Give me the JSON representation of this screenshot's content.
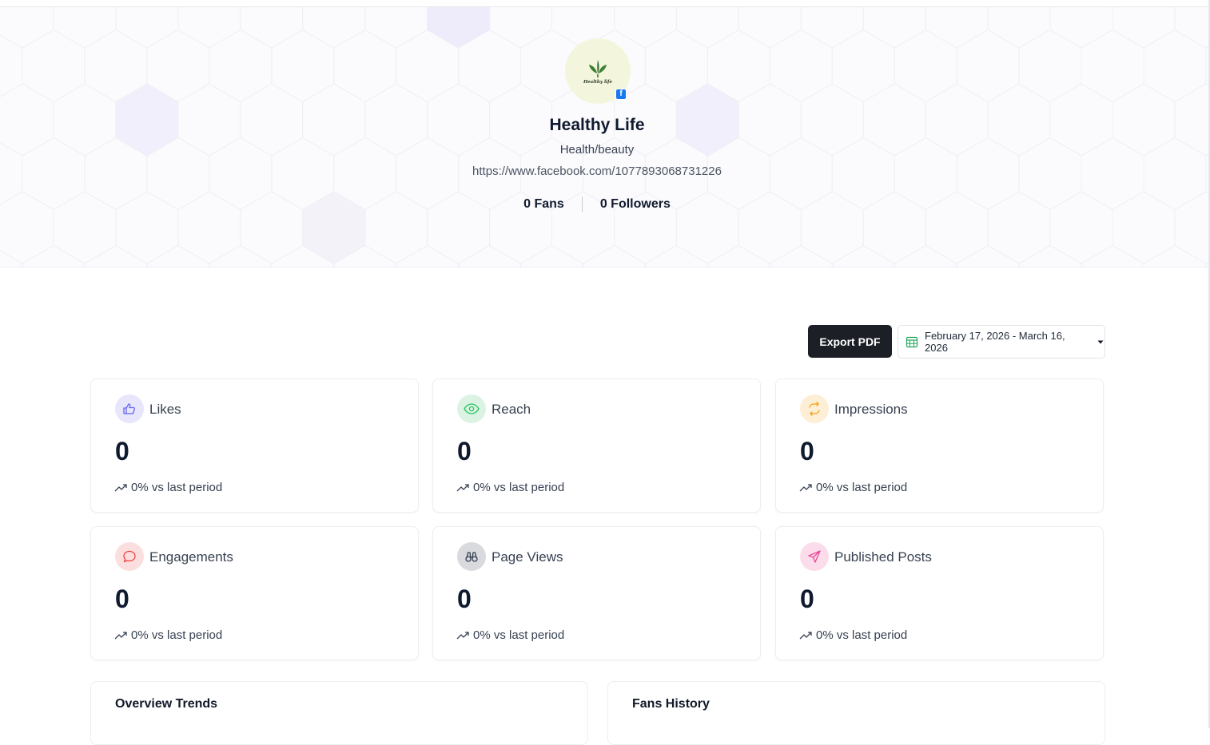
{
  "profile": {
    "avatar_text": "Healthy life",
    "name": "Healthy Life",
    "category": "Health/beauty",
    "url": "https://www.facebook.com/1077893068731226",
    "fans": "0 Fans",
    "followers": "0 Followers",
    "platform_icon": "facebook-icon"
  },
  "toolbar": {
    "export_label": "Export PDF",
    "date_range": "February 17, 2026 - March 16, 2026"
  },
  "metrics": [
    {
      "label": "Likes",
      "value": "0",
      "trend": "0% vs last period",
      "icon": "thumbs-up-icon",
      "color": "#6366f1"
    },
    {
      "label": "Reach",
      "value": "0",
      "trend": "0% vs last period",
      "icon": "eye-icon",
      "color": "#22c55e"
    },
    {
      "label": "Impressions",
      "value": "0",
      "trend": "0% vs last period",
      "icon": "refresh-icon",
      "color": "#f59e0b"
    },
    {
      "label": "Engagements",
      "value": "0",
      "trend": "0% vs last period",
      "icon": "chat-bubble-icon",
      "color": "#ef4444"
    },
    {
      "label": "Page Views",
      "value": "0",
      "trend": "0% vs last period",
      "icon": "binoculars-icon",
      "color": "#4b5563"
    },
    {
      "label": "Published Posts",
      "value": "0",
      "trend": "0% vs last period",
      "icon": "paper-plane-icon",
      "color": "#ec4899"
    }
  ],
  "panels": {
    "overview_title": "Overview Trends",
    "fans_title": "Fans History"
  }
}
